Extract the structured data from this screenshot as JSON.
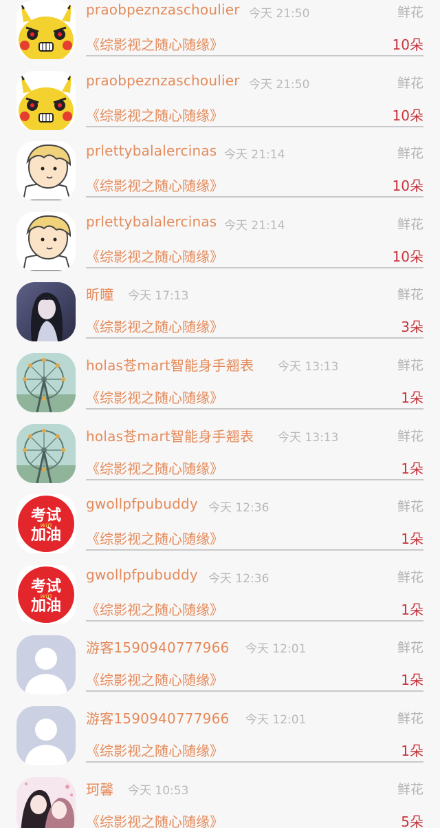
{
  "items": [
    {
      "user": "praobpeznzaschoulier",
      "time": "今天 21:50",
      "gift": "鲜花",
      "book": "《综影视之随心随缘》",
      "count": "10朵",
      "avatar": "pikachu-angry-icon"
    },
    {
      "user": "praobpeznzaschoulier",
      "time": "今天 21:50",
      "gift": "鲜花",
      "book": "《综影视之随心随缘》",
      "count": "10朵",
      "avatar": "pikachu-angry-icon"
    },
    {
      "user": "prlettybalalercinas",
      "time": "今天 21:14",
      "gift": "鲜花",
      "book": "《综影视之随心随缘》",
      "count": "10朵",
      "avatar": "cartoon-boy-icon"
    },
    {
      "user": "prlettybalalercinas",
      "time": "今天 21:14",
      "gift": "鲜花",
      "book": "《综影视之随心随缘》",
      "count": "10朵",
      "avatar": "cartoon-boy-icon"
    },
    {
      "user": "昕瞳",
      "time": "今天 17:13",
      "gift": "鲜花",
      "book": "《综影视之随心随缘》",
      "count": "3朵",
      "avatar": "anime-girl-icon"
    },
    {
      "user": "holas苍mart智能身手翘表",
      "time": "今天 13:13",
      "gift": "鲜花",
      "book": "《综影视之随心随缘》",
      "count": "1朵",
      "avatar": "ferris-wheel-icon"
    },
    {
      "user": "holas苍mart智能身手翘表",
      "time": "今天 13:13",
      "gift": "鲜花",
      "book": "《综影视之随心随缘》",
      "count": "1朵",
      "avatar": "ferris-wheel-icon"
    },
    {
      "user": "gwollpfpubuddy",
      "time": "今天 12:36",
      "gift": "鲜花",
      "book": "《综影视之随心随缘》",
      "count": "1朵",
      "avatar": "exam-cheer-icon"
    },
    {
      "user": "gwollpfpubuddy",
      "time": "今天 12:36",
      "gift": "鲜花",
      "book": "《综影视之随心随缘》",
      "count": "1朵",
      "avatar": "exam-cheer-icon"
    },
    {
      "user": "游客1590940777966",
      "time": "今天 12:01",
      "gift": "鲜花",
      "book": "《综影视之随心随缘》",
      "count": "1朵",
      "avatar": "default-person-icon"
    },
    {
      "user": "游客1590940777966",
      "time": "今天 12:01",
      "gift": "鲜花",
      "book": "《综影视之随心随缘》",
      "count": "1朵",
      "avatar": "default-person-icon"
    },
    {
      "user": "珂馨",
      "time": "今天 10:53",
      "gift": "鲜花",
      "book": "《综影视之随心随缘》",
      "count": "5朵",
      "avatar": "anime-couple-icon"
    }
  ],
  "avatar_text": {
    "exam": "考试",
    "cheer": "加油",
    "win": "win"
  },
  "colors": {
    "username": "#e58a5a",
    "count": "#c8343d",
    "muted": "#b3b3b3",
    "divider": "#c9c9c9"
  }
}
